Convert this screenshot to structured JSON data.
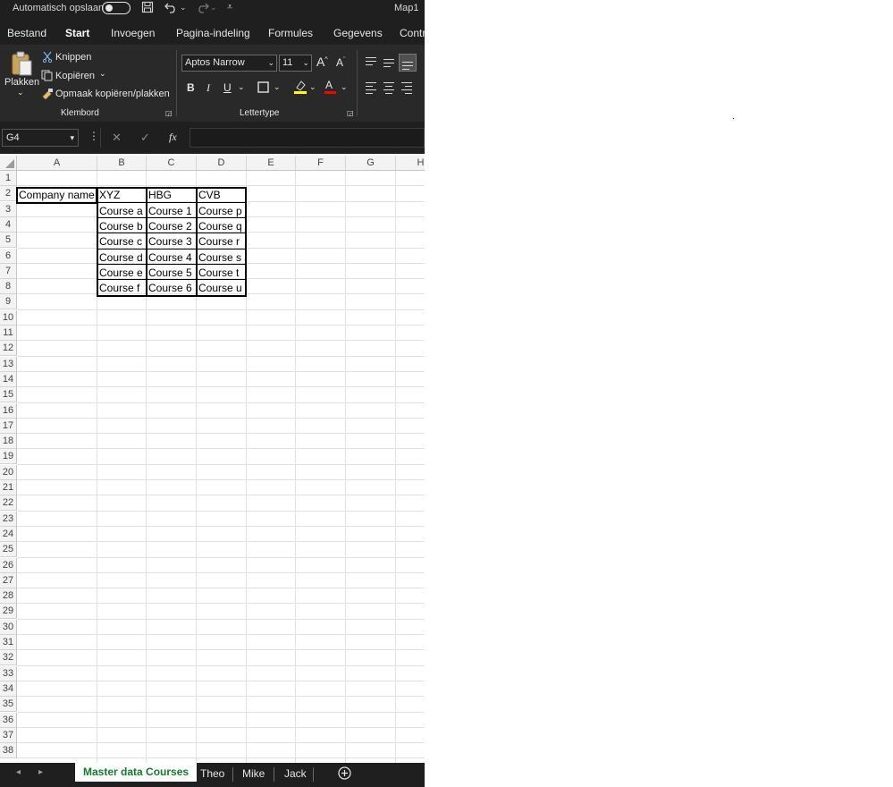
{
  "title_bar": {
    "autosave_label": "Automatisch opslaan",
    "filename": "Map1"
  },
  "ribbon_tabs": [
    "Bestand",
    "Start",
    "Invoegen",
    "Pagina-indeling",
    "Formules",
    "Gegevens",
    "Contr"
  ],
  "active_tab": "Start",
  "clipboard": {
    "paste_label": "Plakken",
    "cut_label": "Knippen",
    "copy_label": "Kopiëren",
    "format_painter_label": "Opmaak kopiëren/plakken",
    "group_label": "Klembord"
  },
  "font": {
    "name": "Aptos Narrow",
    "size": "11",
    "group_label": "Lettertype",
    "bold": "B",
    "italic": "I",
    "underline": "U",
    "grow": "A",
    "shrink": "A",
    "font_color": "A",
    "highlight_color": "#ffff00",
    "text_color": "#ff0000"
  },
  "formula_bar": {
    "name_box": "G4",
    "fx": "fx",
    "formula": ""
  },
  "columns": [
    "A",
    "B",
    "C",
    "D",
    "E",
    "F",
    "G",
    "H"
  ],
  "rows": [
    "1",
    "2",
    "3",
    "4",
    "5",
    "6",
    "7",
    "8",
    "9",
    "10",
    "11",
    "12",
    "13",
    "14",
    "15",
    "16",
    "17",
    "18",
    "19",
    "20",
    "21",
    "22",
    "23",
    "24",
    "25",
    "26",
    "27",
    "28",
    "29",
    "30",
    "31",
    "32",
    "33",
    "34",
    "35",
    "36",
    "37",
    "38"
  ],
  "cells": {
    "A2": "Company name",
    "B2": "XYZ",
    "C2": "HBG",
    "D2": "CVB",
    "B3": "Course a",
    "C3": "Course 1",
    "D3": "Course p",
    "B4": "Course b",
    "C4": "Course 2",
    "D4": "Course q",
    "B5": "Course c",
    "C5": "Course 3",
    "D5": "Course r",
    "B6": "Course d",
    "C6": "Course 4",
    "D6": "Course s",
    "B7": "Course e",
    "C7": "Course 5",
    "D7": "Course t",
    "B8": "Course f",
    "C8": "Course 6",
    "D8": "Course u"
  },
  "sheet_tabs": [
    "Master data Courses",
    "Theo",
    "Mike",
    "Jack"
  ],
  "active_sheet": "Master data Courses",
  "stray_mark": "."
}
